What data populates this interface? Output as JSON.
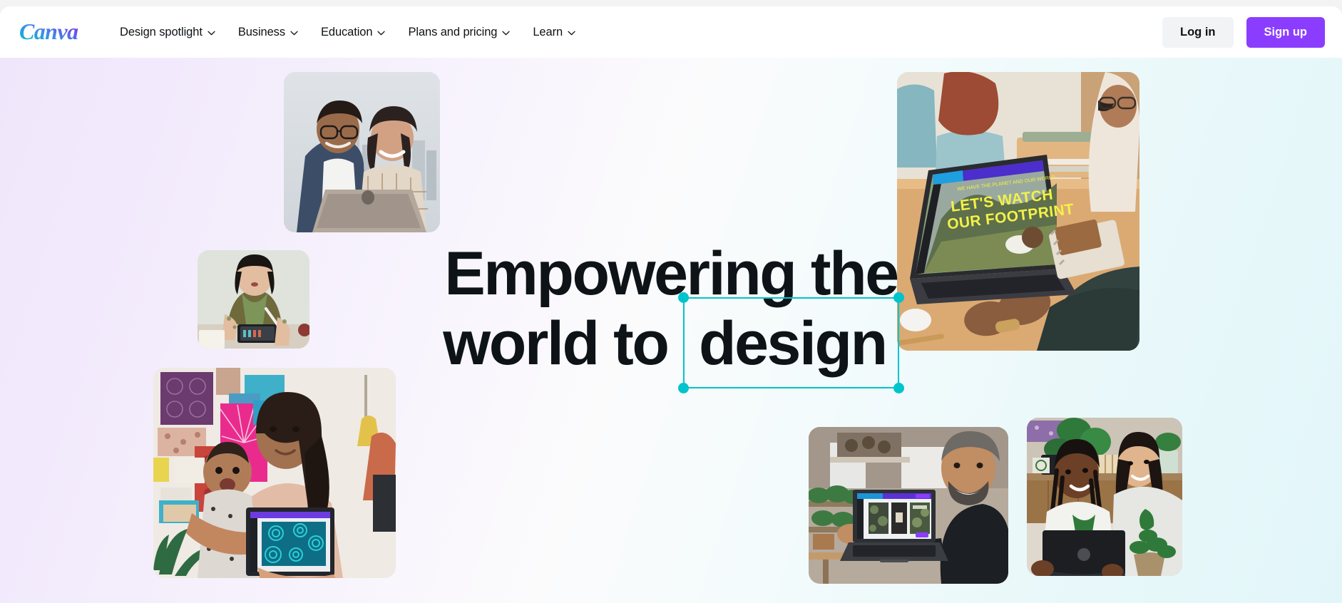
{
  "brand": {
    "name": "Canva",
    "logo_gradient_from": "#00c4cc",
    "logo_gradient_to": "#7d2ae8",
    "accent_purple": "#8b3dff",
    "accent_teal": "#00c4cc"
  },
  "header": {
    "logo_alt": "Canva",
    "nav": [
      {
        "label": "Design spotlight",
        "has_dropdown": true,
        "icon": "chevron-down-icon"
      },
      {
        "label": "Business",
        "has_dropdown": true,
        "icon": "chevron-down-icon"
      },
      {
        "label": "Education",
        "has_dropdown": true,
        "icon": "chevron-down-icon"
      },
      {
        "label": "Plans and pricing",
        "has_dropdown": true,
        "icon": "chevron-down-icon"
      },
      {
        "label": "Learn",
        "has_dropdown": true,
        "icon": "chevron-down-icon"
      }
    ],
    "login_label": "Log in",
    "signup_label": "Sign up"
  },
  "hero": {
    "headline_line1": "Empowering the",
    "headline_line2_prefix": "world to",
    "headline_selected_word": "design",
    "selection": {
      "color": "#00c4cc",
      "handles": 4,
      "state": "selected"
    },
    "background": {
      "from": "#f0e6fb",
      "to": "#e2f6f9",
      "direction": "diagonal left-lavender to right-cyan"
    },
    "photos": [
      {
        "id": "photo-two-people-laptop",
        "alt": "Two people smiling at a laptop with a city skyline behind them",
        "position": "top-center-left"
      },
      {
        "id": "photo-woman-tablet-drawing",
        "alt": "Woman with bob haircut drawing on a tablet with a stylus",
        "position": "left-middle"
      },
      {
        "id": "photo-person-laptop-footprint",
        "alt": "Person at a laptop showing a Canva design reading LET'S WATCH OUR FOOTPRINT",
        "position": "top-right",
        "screen_text_line1": "LET'S WATCH",
        "screen_text_line2": "OUR FOOTPRINT"
      },
      {
        "id": "photo-mother-baby-tablet",
        "alt": "Woman holding a baby and a tablet showing a blue circular pattern design",
        "position": "bottom-left"
      },
      {
        "id": "photo-man-laptop-plants",
        "alt": "Smiling bearded man holding a laptop showing a Canva design",
        "position": "bottom-center-right"
      },
      {
        "id": "photo-two-women-plant-shop",
        "alt": "Two women smiling together with a laptop in a plant shop",
        "position": "bottom-right"
      }
    ]
  }
}
